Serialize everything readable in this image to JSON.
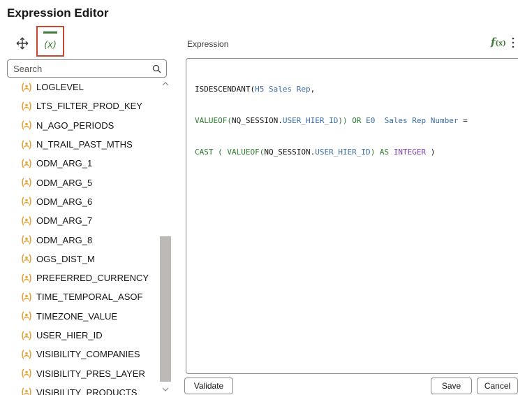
{
  "title": "Expression Editor",
  "toolbar": {
    "move_icon": "move-icon",
    "variables_tab_label": "(x)"
  },
  "search": {
    "placeholder": "Search"
  },
  "variables": [
    "LOGLEVEL",
    "LTS_FILTER_PROD_KEY",
    "N_AGO_PERIODS",
    "N_TRAIL_PAST_MTHS",
    "ODM_ARG_1",
    "ODM_ARG_5",
    "ODM_ARG_6",
    "ODM_ARG_7",
    "ODM_ARG_8",
    "OGS_DIST_M",
    "PREFERRED_CURRENCY",
    "TIME_TEMPORAL_ASOF",
    "TIMEZONE_VALUE",
    "USER_HIER_ID",
    "VISIBILITY_COMPANIES",
    "VISIBILITY_PRES_LAYER",
    "VISIBILITY_PRODUCTS"
  ],
  "expression": {
    "label": "Expression",
    "fx_label": "f",
    "fx_sub": "(x)",
    "line1": [
      "ISDESCENDANT(",
      "H5 Sales Rep",
      ","
    ],
    "line2": [
      "VALUEOF(",
      "NQ_SESSION",
      ".",
      "USER_HIER_ID",
      "))",
      " OR ",
      "E0  Sales Rep Number",
      " ="
    ],
    "line3": [
      "CAST ( ",
      "VALUEOF(",
      "NQ_SESSION",
      ".",
      "USER_HIER_ID",
      ")",
      " AS ",
      "INTEGER",
      " )"
    ]
  },
  "buttons": {
    "validate": "Validate",
    "save": "Save",
    "cancel": "Cancel"
  },
  "colors": {
    "accent_green": "#3f7b3c",
    "variable_icon": "#e8a23a",
    "selection_border": "#c74634"
  }
}
